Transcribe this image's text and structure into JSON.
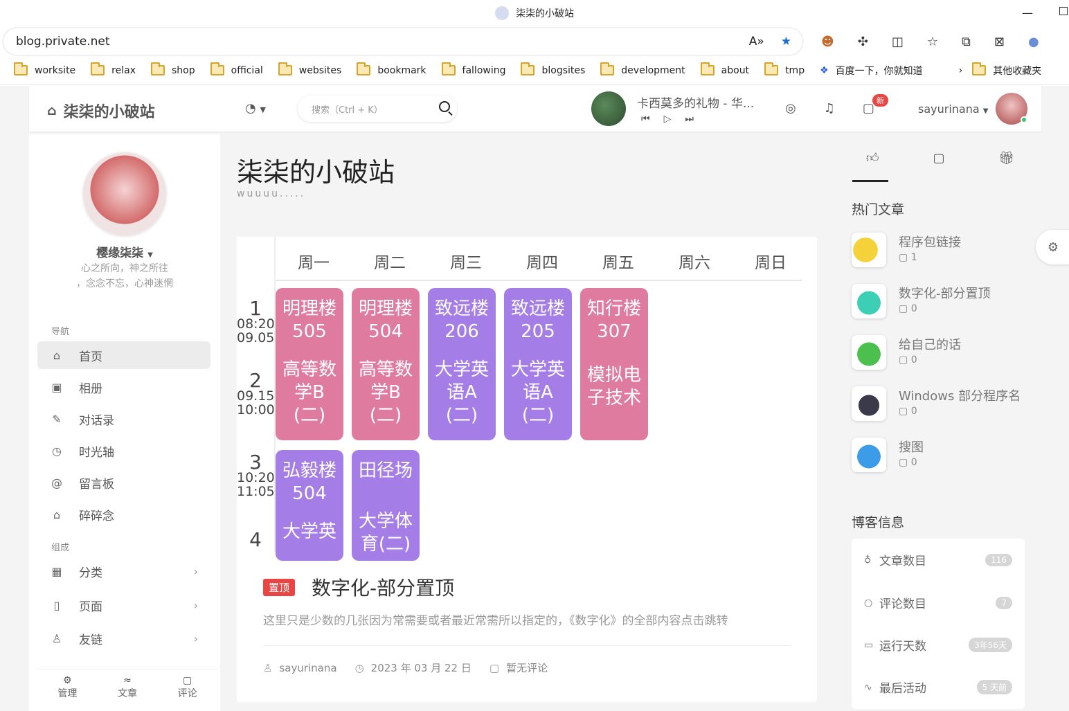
{
  "browser": {
    "tab_title": "柒柒的小破站",
    "url": "blog.private.net",
    "bookmarks": [
      "worksite",
      "relax",
      "shop",
      "official",
      "websites",
      "bookmark",
      "fallowing",
      "blogsites",
      "development",
      "about",
      "tmp"
    ],
    "baidu_label": "百度一下，你就知道",
    "other_bookmarks": "其他收藏夹"
  },
  "header": {
    "site_name": "柒柒的小破站",
    "search_placeholder": "搜索（Ctrl + K）",
    "song_title": "卡西莫多的礼物 - 华...",
    "new_badge": "新",
    "username": "sayurinana"
  },
  "sidebar": {
    "name": "樱缘柒柒",
    "desc1": "心之所向，神之所往",
    "desc2": "，念念不忘，心神迷惘",
    "nav_section": "导航",
    "nav_items": [
      "首页",
      "相册",
      "对话录",
      "时光轴",
      "留言板",
      "碎碎念"
    ],
    "group_section": "组成",
    "group_items": [
      "分类",
      "页面",
      "友链"
    ],
    "footer": [
      "管理",
      "文章",
      "评论"
    ]
  },
  "main": {
    "title": "柒柒的小破站",
    "subtitle": "wuuuu.....",
    "days": [
      "周一",
      "周二",
      "周三",
      "周四",
      "周五",
      "周六",
      "周日"
    ],
    "rows": [
      {
        "n": "1",
        "t1": "08:20",
        "t2": "09.05"
      },
      {
        "n": "2",
        "t1": "09.15",
        "t2": "10:00"
      },
      {
        "n": "3",
        "t1": "10:20",
        "t2": "11:05"
      },
      {
        "n": "4",
        "t1": "",
        "t2": ""
      }
    ],
    "courses": [
      {
        "l1": "明理楼",
        "l2": "505",
        "l3": "高等数",
        "l4": "学B",
        "l5": "(二)"
      },
      {
        "l1": "明理楼",
        "l2": "504",
        "l3": "高等数",
        "l4": "学B",
        "l5": "(二)"
      },
      {
        "l1": "致远楼",
        "l2": "206",
        "l3": "大学英",
        "l4": "语A",
        "l5": "(二)"
      },
      {
        "l1": "致远楼",
        "l2": "205",
        "l3": "大学英",
        "l4": "语A",
        "l5": "(二)"
      },
      {
        "l1": "知行楼",
        "l2": "307",
        "l3": "模拟电",
        "l4": "子技术",
        "l5": ""
      },
      {
        "l1": "弘毅楼",
        "l2": "504",
        "l3": "大学英",
        "l4": "",
        "l5": ""
      },
      {
        "l1": "田径场",
        "l2": "",
        "l3": "大学体",
        "l4": "育(二)",
        "l5": ""
      }
    ],
    "post_badge": "置顶",
    "post_title": "数字化-部分置顶",
    "post_desc": "这里只是少数的几张因为常需要或者最近常需所以指定的，《数字化》的全部内容点击跳转",
    "post_author": "sayurinana",
    "post_date": "2023 年 03 月 22 日",
    "post_comments": "暂无评论"
  },
  "right": {
    "hot_title": "热门文章",
    "hot": [
      {
        "title": "程序包链接",
        "count": "1"
      },
      {
        "title": "数字化-部分置顶",
        "count": "0"
      },
      {
        "title": "给自己的话",
        "count": "0"
      },
      {
        "title": "Windows 部分程序名",
        "count": "0"
      },
      {
        "title": "搜图",
        "count": "0"
      }
    ],
    "info_title": "博客信息",
    "info": [
      {
        "label": "文章数目",
        "value": "116"
      },
      {
        "label": "评论数目",
        "value": "7"
      },
      {
        "label": "运行天数",
        "value": "3年56天"
      },
      {
        "label": "最后活动",
        "value": "5 天前"
      }
    ]
  }
}
